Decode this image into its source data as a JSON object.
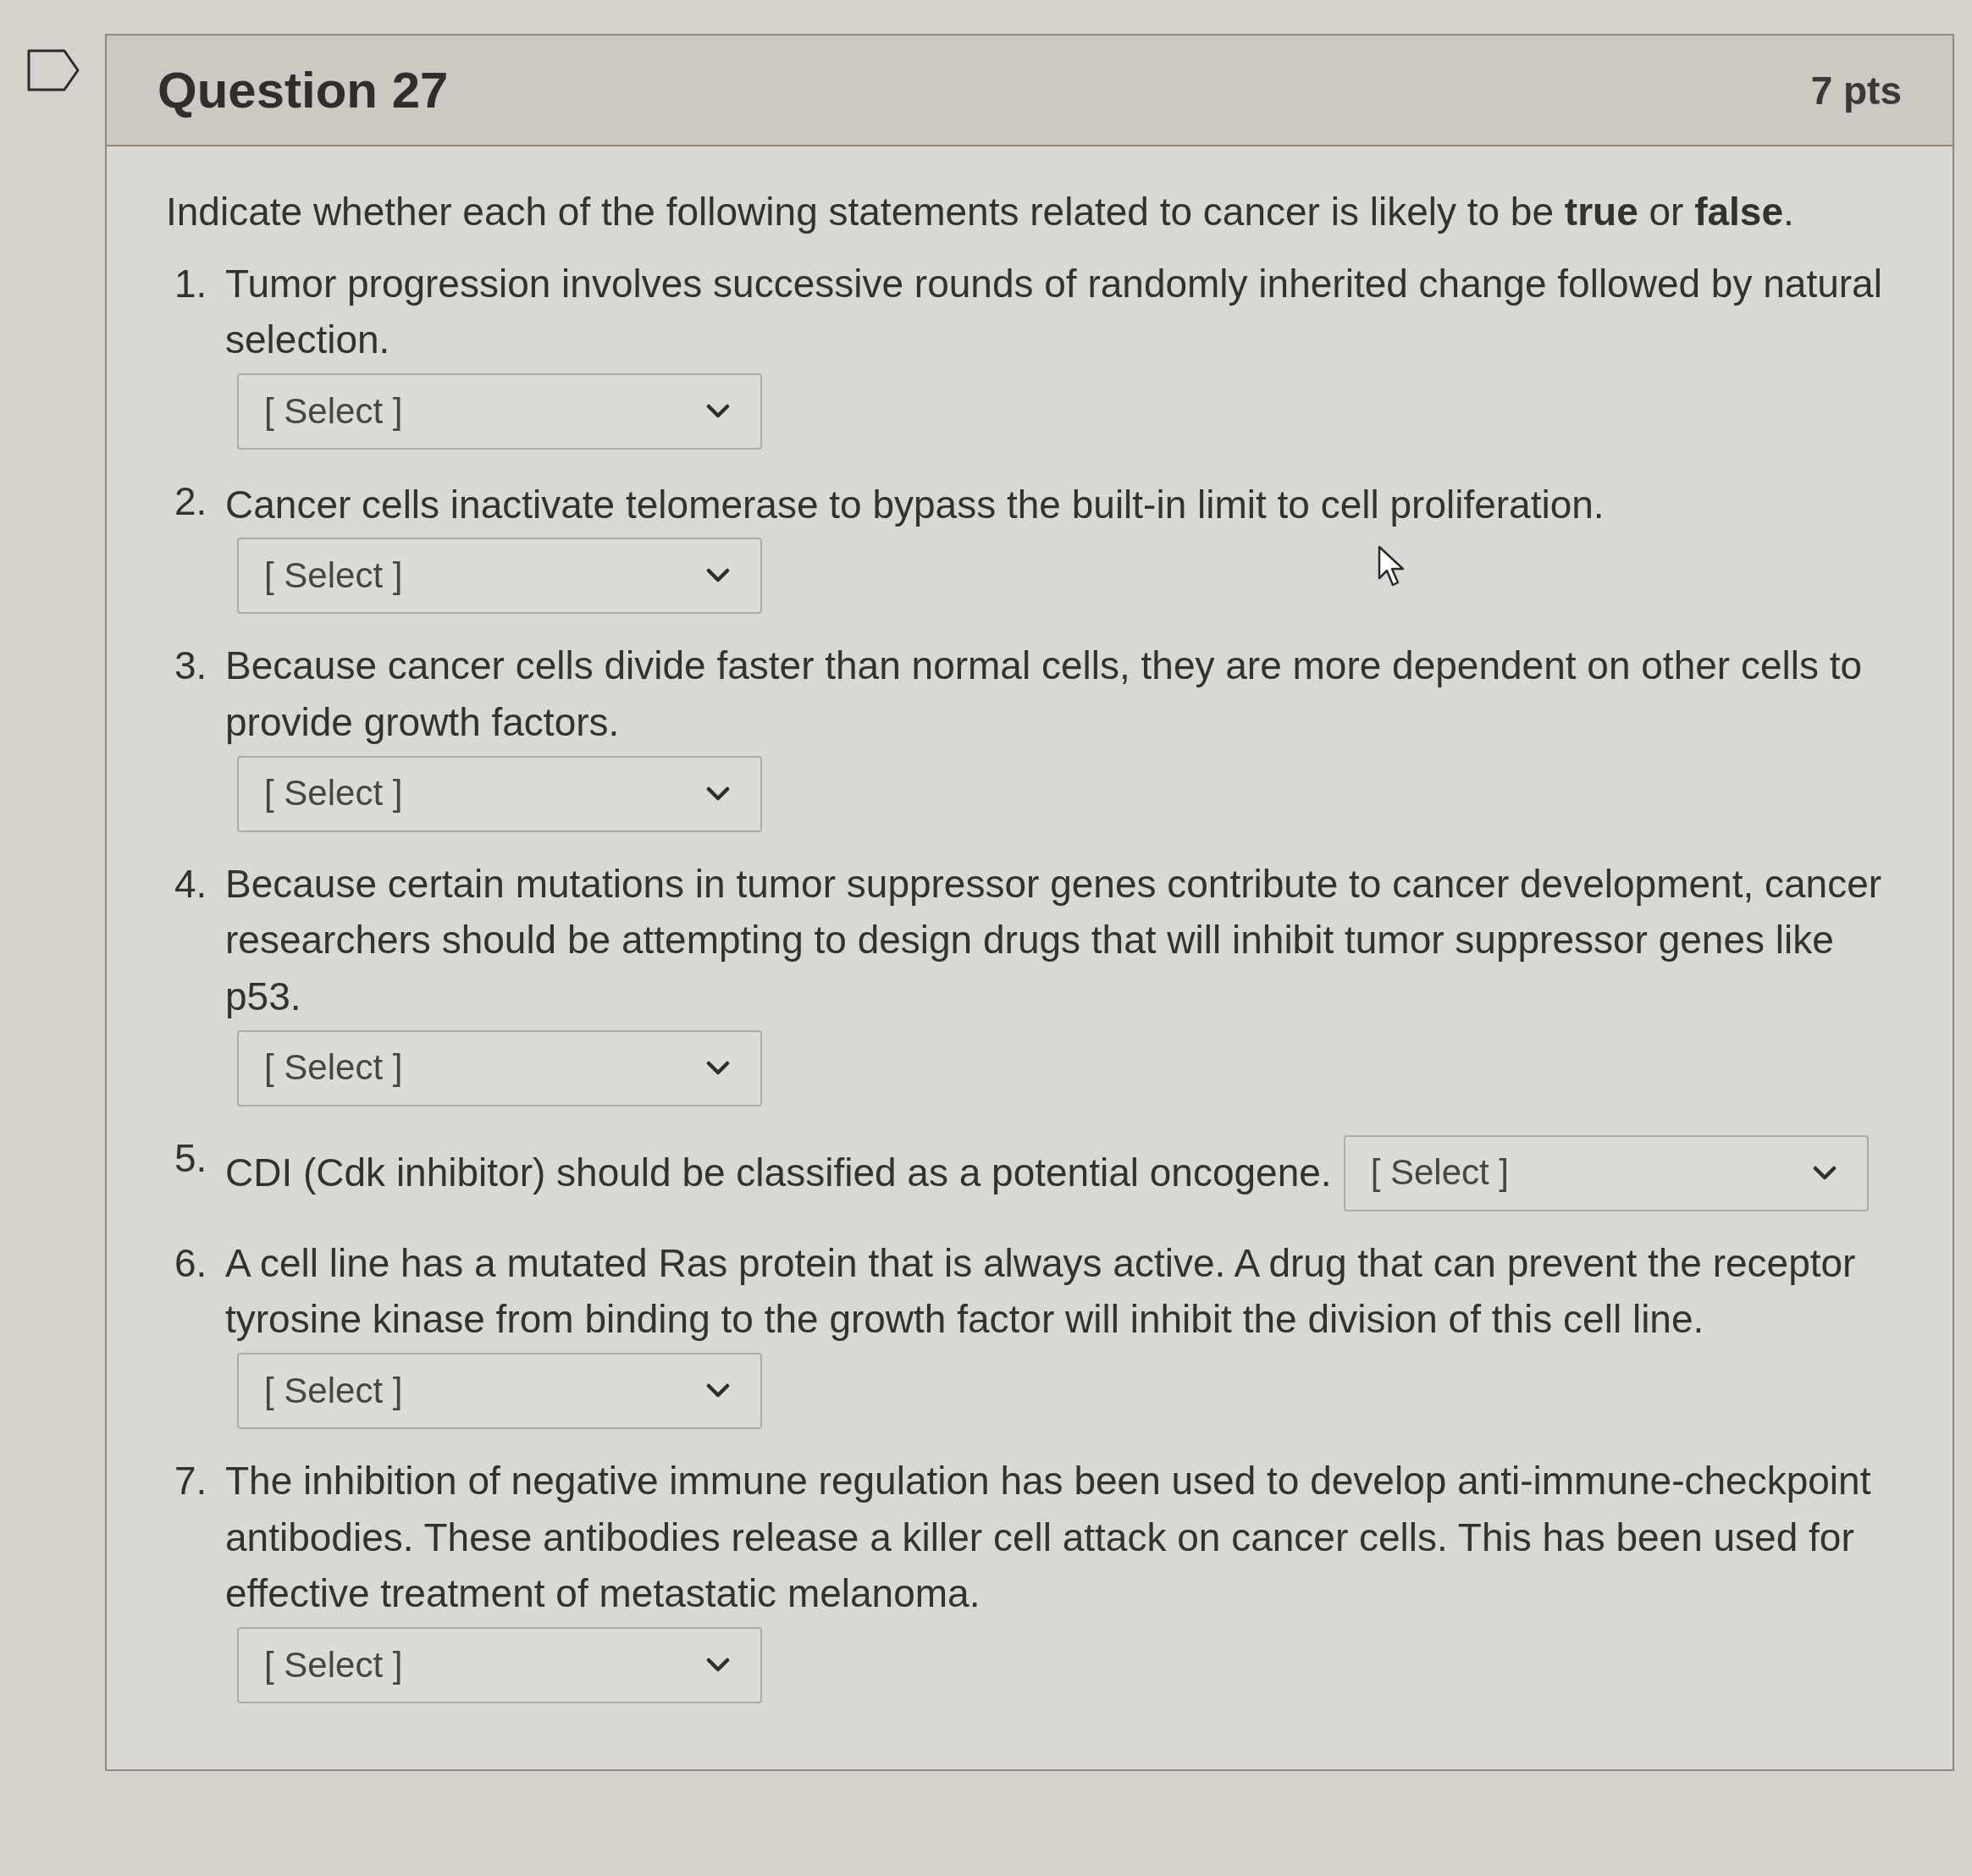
{
  "question": {
    "title": "Question 27",
    "points": "7 pts",
    "prompt": "Indicate whether each of the following statements related to cancer is likely to be **true** or **false**.",
    "items": [
      {
        "number": "1.",
        "text": "Tumor progression involves successive rounds of randomly inherited change followed by natural selection.",
        "value": "[ Select ]"
      },
      {
        "number": "2.",
        "text": "Cancer cells inactivate telomerase to bypass the built-in limit to cell proliferation.",
        "value": "[ Select ]"
      },
      {
        "number": "3.",
        "text": "Because cancer cells divide faster than normal cells, they are more dependent on other cells to provide growth factors.",
        "value": "[ Select ]"
      },
      {
        "number": "4.",
        "text": "Because certain mutations in tumor suppressor genes contribute to cancer development, cancer researchers should be attempting to design drugs that will inhibit tumor suppressor genes like p53.",
        "value": "[ Select ]"
      },
      {
        "number": "5.",
        "text": "CDI (Cdk inhibitor) should be classified as a potential oncogene.",
        "value": "[ Select ]"
      },
      {
        "number": "6.",
        "text": "A cell line has a mutated Ras protein that is always active. A drug that can prevent the receptor tyrosine kinase from binding to the growth factor will inhibit the division of this cell line.",
        "value": "[ Select ]"
      },
      {
        "number": "7.",
        "text": "The inhibition of negative immune regulation has been used to develop anti-immune-checkpoint antibodies. These antibodies release a killer cell attack on cancer cells. This has been used for effective treatment of metastatic melanoma.",
        "value": "[ Select ]"
      }
    ]
  }
}
